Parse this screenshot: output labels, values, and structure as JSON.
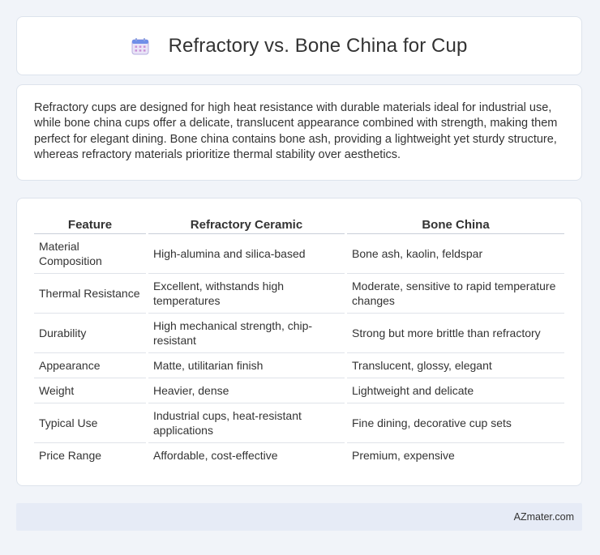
{
  "header": {
    "title": "Refractory vs. Bone China for Cup",
    "icon": "calendar-icon"
  },
  "intro": {
    "text": "Refractory cups are designed for high heat resistance with durable materials ideal for industrial use, while bone china cups offer a delicate, translucent appearance combined with strength, making them perfect for elegant dining. Bone china contains bone ash, providing a lightweight yet sturdy structure, whereas refractory materials prioritize thermal stability over aesthetics."
  },
  "table": {
    "headers": [
      "Feature",
      "Refractory Ceramic",
      "Bone China"
    ],
    "rows": [
      [
        "Material Composition",
        "High-alumina and silica-based",
        "Bone ash, kaolin, feldspar"
      ],
      [
        "Thermal Resistance",
        "Excellent, withstands high temperatures",
        "Moderate, sensitive to rapid temperature changes"
      ],
      [
        "Durability",
        "High mechanical strength, chip-resistant",
        "Strong but more brittle than refractory"
      ],
      [
        "Appearance",
        "Matte, utilitarian finish",
        "Translucent, glossy, elegant"
      ],
      [
        "Weight",
        "Heavier, dense",
        "Lightweight and delicate"
      ],
      [
        "Typical Use",
        "Industrial cups, heat-resistant applications",
        "Fine dining, decorative cup sets"
      ],
      [
        "Price Range",
        "Affordable, cost-effective",
        "Premium, expensive"
      ]
    ]
  },
  "footer": {
    "text": "AZmater.com"
  },
  "colors": {
    "page_background": "#f1f4f9",
    "card_background": "#ffffff",
    "footer_background": "#e6ebf6",
    "text": "#333333"
  }
}
